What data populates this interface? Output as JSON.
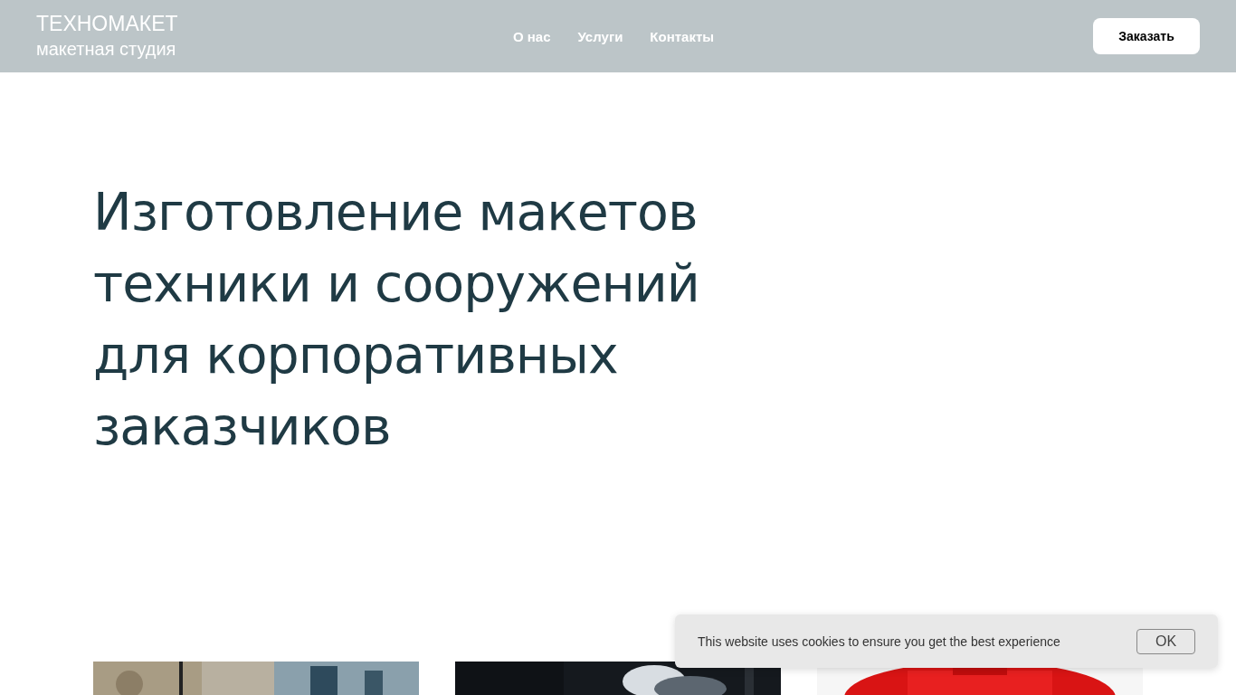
{
  "header": {
    "logo_title": "ТЕХНОМАКЕТ",
    "logo_subtitle": "макетная студия",
    "nav": [
      {
        "label": "О нас"
      },
      {
        "label": "Услуги"
      },
      {
        "label": "Контакты"
      }
    ],
    "order_button": "Заказать"
  },
  "hero": {
    "title": "Изготовление макетов техники и сооружений для корпоративных заказчиков"
  },
  "cookie_banner": {
    "text": "This website uses cookies to ensure you get the best experience",
    "button": "OK"
  }
}
